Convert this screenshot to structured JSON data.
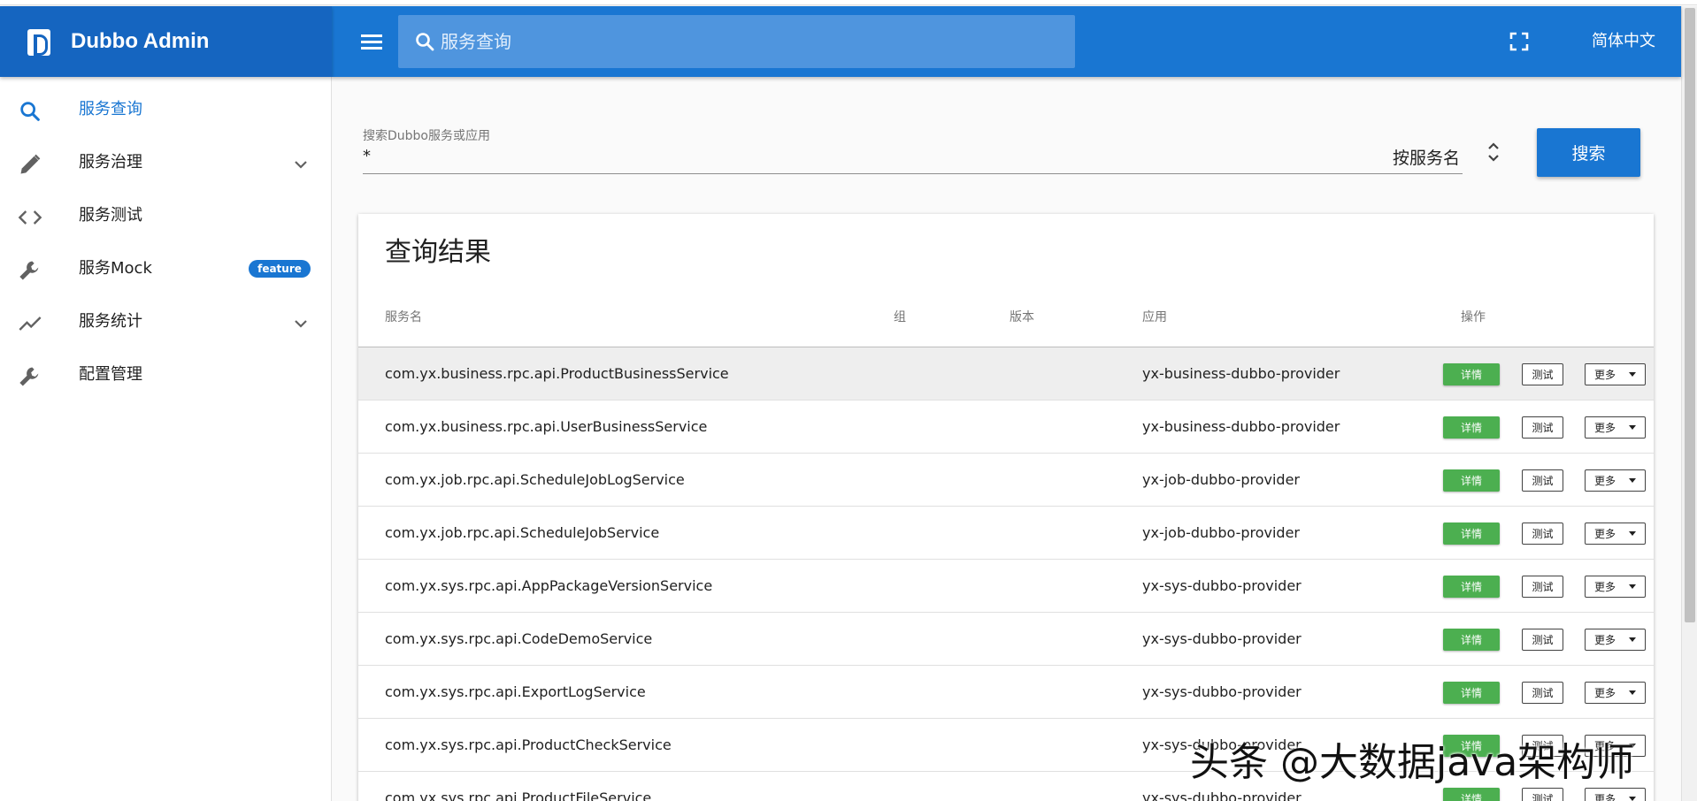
{
  "brand": {
    "title": "Dubbo Admin",
    "color": "#1565c0"
  },
  "topbar": {
    "search_placeholder": "服务查询",
    "language": "简体中文",
    "color": "#1976d2",
    "icons": [
      "menu-icon",
      "search-icon",
      "fullscreen-icon"
    ]
  },
  "sidebar": {
    "items": [
      {
        "label": "服务查询",
        "icon": "search-icon",
        "active": true
      },
      {
        "label": "服务治理",
        "icon": "pencil-icon",
        "expandable": true
      },
      {
        "label": "服务测试",
        "icon": "code-icon"
      },
      {
        "label": "服务Mock",
        "icon": "wrench-icon",
        "badge": "feature"
      },
      {
        "label": "服务统计",
        "icon": "trending-icon",
        "expandable": true
      },
      {
        "label": "配置管理",
        "icon": "wrench-icon"
      }
    ]
  },
  "search": {
    "field_label": "搜索Dubbo服务或应用",
    "value": "*",
    "type": "按服务名",
    "button": "搜索"
  },
  "results": {
    "title": "查询结果",
    "columns": [
      "服务名",
      "组",
      "版本",
      "应用",
      "操作"
    ],
    "rows": [
      {
        "service": "com.yx.business.rpc.api.ProductBusinessService",
        "group": "",
        "version": "",
        "app": "yx-business-dubbo-provider"
      },
      {
        "service": "com.yx.business.rpc.api.UserBusinessService",
        "group": "",
        "version": "",
        "app": "yx-business-dubbo-provider"
      },
      {
        "service": "com.yx.job.rpc.api.ScheduleJobLogService",
        "group": "",
        "version": "",
        "app": "yx-job-dubbo-provider"
      },
      {
        "service": "com.yx.job.rpc.api.ScheduleJobService",
        "group": "",
        "version": "",
        "app": "yx-job-dubbo-provider"
      },
      {
        "service": "com.yx.sys.rpc.api.AppPackageVersionService",
        "group": "",
        "version": "",
        "app": "yx-sys-dubbo-provider"
      },
      {
        "service": "com.yx.sys.rpc.api.CodeDemoService",
        "group": "",
        "version": "",
        "app": "yx-sys-dubbo-provider"
      },
      {
        "service": "com.yx.sys.rpc.api.ExportLogService",
        "group": "",
        "version": "",
        "app": "yx-sys-dubbo-provider"
      },
      {
        "service": "com.yx.sys.rpc.api.ProductCheckService",
        "group": "",
        "version": "",
        "app": "yx-sys-dubbo-provider"
      },
      {
        "service": "com.yx.sys.rpc.api.ProductFileService",
        "group": "",
        "version": "",
        "app": "yx-sys-dubbo-provider"
      }
    ],
    "actions": {
      "detail": "详情",
      "test": "测试",
      "more": "更多"
    },
    "detail_color": "#4caf50"
  },
  "watermark": "头条 @大数据java架构师"
}
